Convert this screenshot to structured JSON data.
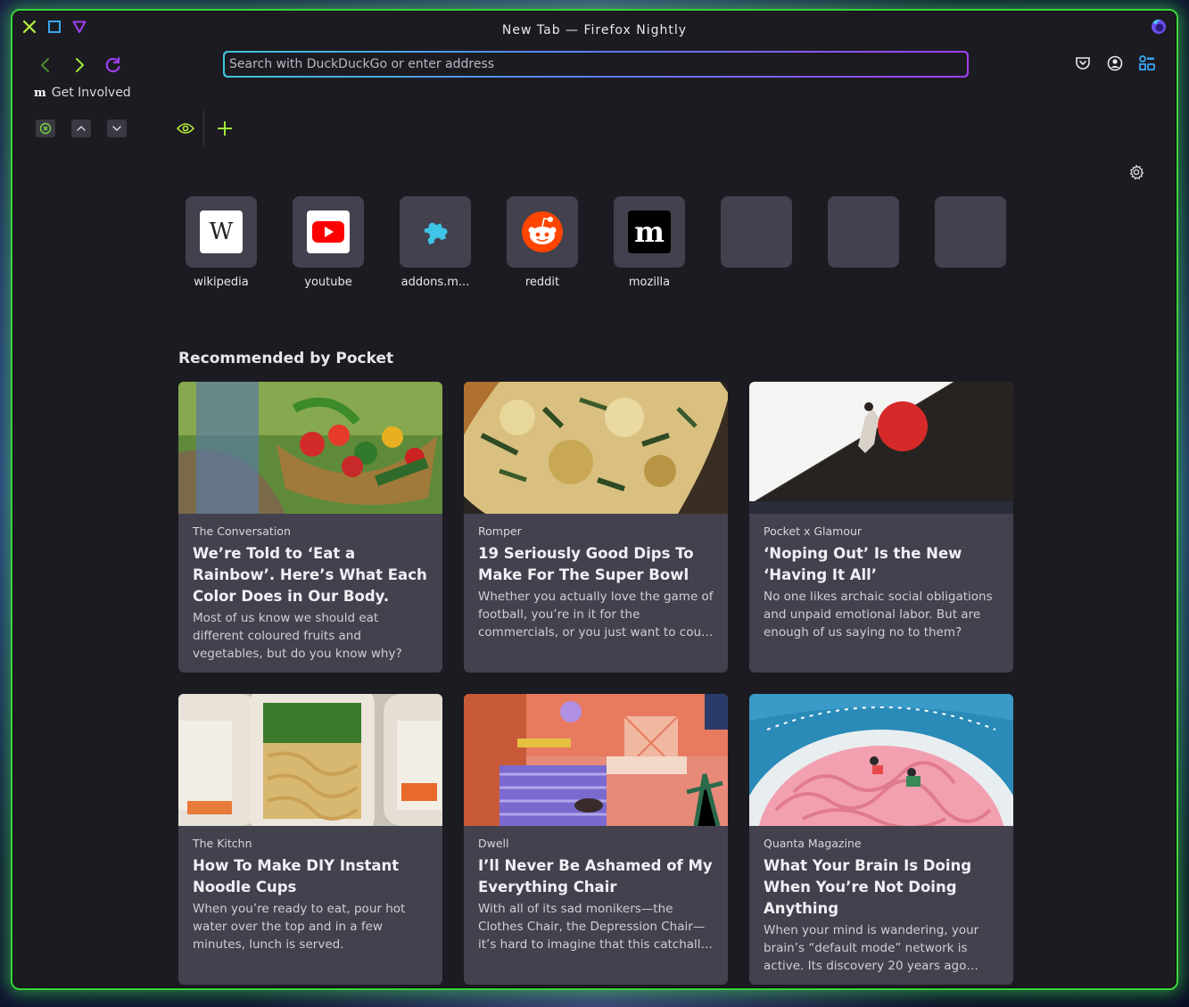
{
  "window": {
    "title": "New Tab — Firefox Nightly",
    "controls": [
      "close-icon",
      "maximize-icon",
      "minimize-icon"
    ]
  },
  "nav": {
    "back_icon": "chevron-left-icon",
    "forward_icon": "chevron-right-icon",
    "reload_icon": "reload-icon"
  },
  "urlbar": {
    "placeholder": "Search with DuckDuckGo or enter address",
    "value": ""
  },
  "toolbar_right": [
    "pocket-icon",
    "account-icon",
    "extensions-icon"
  ],
  "bookmarks": [
    {
      "icon_letter": "m",
      "label": "Get Involved"
    }
  ],
  "top_sites": [
    {
      "label": "wikipedia",
      "icon": "W"
    },
    {
      "label": "youtube",
      "icon": "play"
    },
    {
      "label": "addons.m...",
      "icon": "puzzle"
    },
    {
      "label": "reddit",
      "icon": "reddit"
    },
    {
      "label": "mozilla",
      "icon": "m"
    },
    {
      "label": ""
    },
    {
      "label": ""
    },
    {
      "label": ""
    }
  ],
  "pocket": {
    "heading": "Recommended by Pocket",
    "cards": [
      {
        "source": "The Conversation",
        "title": "We’re Told to ‘Eat a Rainbow’. Here’s What Each Color Does in Our Body.",
        "desc": "Most of us know we should eat different coloured fruits and vegetables, but do you know why?"
      },
      {
        "source": "Romper",
        "title": "19 Seriously Good Dips To Make For The Super Bowl",
        "desc": "Whether you actually love the game of football, you’re in it for the commercials, or you just want to cou…"
      },
      {
        "source": "Pocket x Glamour",
        "title": "‘Noping Out’ Is the New ‘Having It All’",
        "desc": "No one likes archaic social obligations and unpaid emotional labor. But are enough of us saying no to them?"
      },
      {
        "source": "The Kitchn",
        "title": "How To Make DIY Instant Noodle Cups",
        "desc": "When you’re ready to eat, pour hot water over the top and in a few minutes, lunch is served."
      },
      {
        "source": "Dwell",
        "title": "I’ll Never Be Ashamed of My Everything Chair",
        "desc": "With all of its sad monikers—the Clothes Chair, the Depression Chair—it’s hard to imagine that this catchall…"
      },
      {
        "source": "Quanta Magazine",
        "title": "What Your Brain Is Doing When You’re Not Doing Anything",
        "desc": "When your mind is wandering, your brain’s “default mode” network is active. Its discovery 20 years ago…"
      }
    ]
  },
  "colors": {
    "background": "#1c1b22",
    "tile": "#42414d",
    "border_glow": "#3bd43b",
    "accent_green": "#7cd64a",
    "accent_purple": "#a23ff0",
    "accent_cyan": "#3fc5d8"
  }
}
